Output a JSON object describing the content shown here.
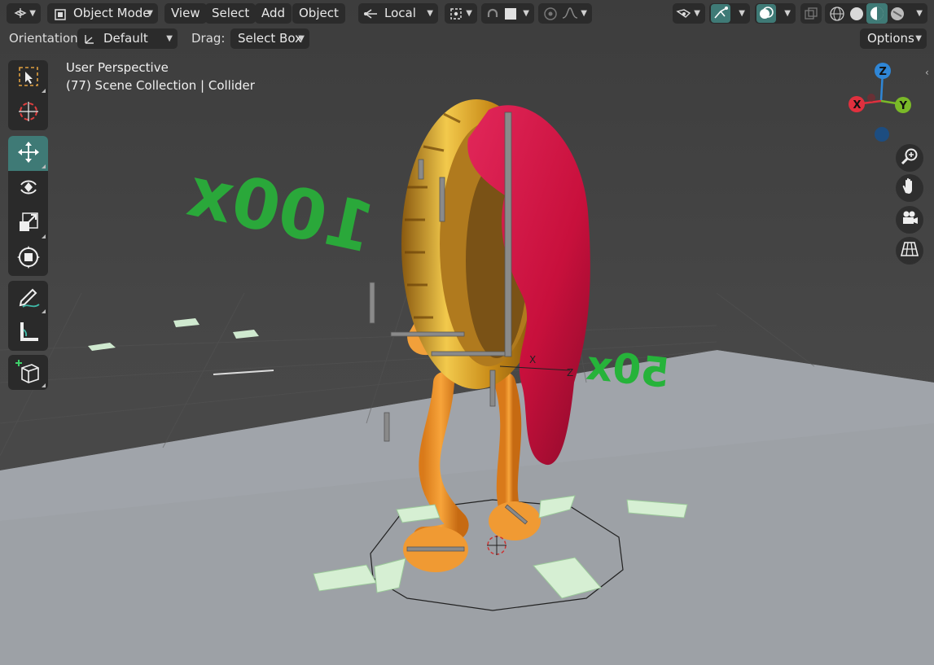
{
  "header": {
    "editor_type_icon": "3d-viewport-icon",
    "mode_label": "Object Mode",
    "menus": [
      "View",
      "Select",
      "Add",
      "Object"
    ],
    "transform_orientation": "Local"
  },
  "toolheader": {
    "orientation_label": "Orientation:",
    "orientation_value": "Default",
    "drag_label": "Drag:",
    "drag_value": "Select Box",
    "options_label": "Options"
  },
  "overlay_text": {
    "view_name": "User Perspective",
    "collection_info": "(77) Scene Collection | Collider"
  },
  "gizmo": {
    "x": "X",
    "y": "Y",
    "z": "Z"
  },
  "toolbar_items": [
    {
      "name": "select-box-tool",
      "icon": "cursor-select-icon",
      "active": false
    },
    {
      "name": "cursor-tool",
      "icon": "crosshair-cursor-icon",
      "active": false
    },
    {
      "name": "move-tool",
      "icon": "move-arrows-icon",
      "active": true
    },
    {
      "name": "rotate-tool",
      "icon": "rotate-icon",
      "active": false
    },
    {
      "name": "scale-tool",
      "icon": "scale-icon",
      "active": false
    },
    {
      "name": "transform-tool",
      "icon": "transform-icon",
      "active": false
    },
    {
      "name": "annotate-tool",
      "icon": "pencil-icon",
      "active": false
    },
    {
      "name": "measure-tool",
      "icon": "ruler-icon",
      "active": false
    },
    {
      "name": "add-cube-tool",
      "icon": "add-cube-icon",
      "active": false
    }
  ],
  "nav_buttons": [
    "zoom-icon",
    "hand-pan-icon",
    "camera-icon",
    "grid-ortho-icon"
  ],
  "scene_text": {
    "big_label": "100x",
    "small_label": "50x"
  },
  "colors": {
    "accent": "#3f7a76",
    "header_bg": "#2b2b2b",
    "toolbar_bg": "#2a2a2a",
    "x_axis": "#e0303e",
    "y_axis": "#7ab928",
    "z_axis": "#2f86d6"
  }
}
